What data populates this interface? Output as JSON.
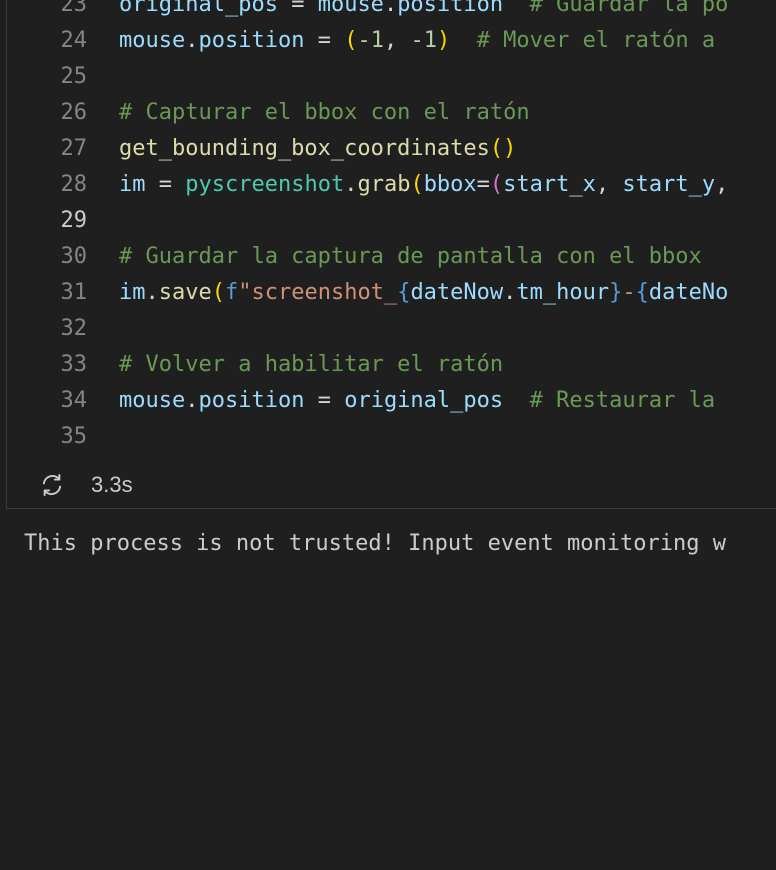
{
  "colors": {
    "background": "#1f1f1f",
    "line_number": "#858585",
    "line_number_current": "#cccccc",
    "variable": "#9cdcfe",
    "function": "#dcdcaa",
    "class": "#4ec9b0",
    "number": "#b5cea8",
    "string": "#ce9178",
    "comment": "#6a9955",
    "bracket_1": "#ffd700",
    "bracket_2": "#da70d6",
    "bracket_3": "#179fff"
  },
  "editor": {
    "current_line": 29,
    "lines": [
      {
        "num": "23",
        "tokens": [
          {
            "t": "original_pos",
            "c": "var"
          },
          {
            "t": " = ",
            "c": "op"
          },
          {
            "t": "mouse",
            "c": "var"
          },
          {
            "t": ".",
            "c": "op"
          },
          {
            "t": "position",
            "c": "var"
          },
          {
            "t": "  # Guardar la po",
            "c": "com"
          }
        ]
      },
      {
        "num": "24",
        "tokens": [
          {
            "t": "mouse",
            "c": "var"
          },
          {
            "t": ".",
            "c": "op"
          },
          {
            "t": "position",
            "c": "var"
          },
          {
            "t": " = ",
            "c": "op"
          },
          {
            "t": "(",
            "c": "br1"
          },
          {
            "t": "-1",
            "c": "num"
          },
          {
            "t": ", ",
            "c": "op"
          },
          {
            "t": "-1",
            "c": "num"
          },
          {
            "t": ")",
            "c": "br1"
          },
          {
            "t": "  # Mover el ratón a",
            "c": "com"
          }
        ]
      },
      {
        "num": "25",
        "tokens": []
      },
      {
        "num": "26",
        "tokens": [
          {
            "t": "# Capturar el bbox con el ratón",
            "c": "com"
          }
        ]
      },
      {
        "num": "27",
        "tokens": [
          {
            "t": "get_bounding_box_coordinates",
            "c": "fn"
          },
          {
            "t": "()",
            "c": "br1"
          }
        ]
      },
      {
        "num": "28",
        "tokens": [
          {
            "t": "im",
            "c": "var"
          },
          {
            "t": " = ",
            "c": "op"
          },
          {
            "t": "pyscreenshot",
            "c": "cls"
          },
          {
            "t": ".",
            "c": "op"
          },
          {
            "t": "grab",
            "c": "fn"
          },
          {
            "t": "(",
            "c": "br1"
          },
          {
            "t": "bbox",
            "c": "var"
          },
          {
            "t": "=",
            "c": "op"
          },
          {
            "t": "(",
            "c": "br2"
          },
          {
            "t": "start_x",
            "c": "var"
          },
          {
            "t": ", ",
            "c": "op"
          },
          {
            "t": "start_y",
            "c": "var"
          },
          {
            "t": ",",
            "c": "op"
          }
        ]
      },
      {
        "num": "29",
        "tokens": []
      },
      {
        "num": "30",
        "tokens": [
          {
            "t": "# Guardar la captura de pantalla con el bbox",
            "c": "com"
          }
        ]
      },
      {
        "num": "31",
        "tokens": [
          {
            "t": "im",
            "c": "var"
          },
          {
            "t": ".",
            "c": "op"
          },
          {
            "t": "save",
            "c": "fn"
          },
          {
            "t": "(",
            "c": "br1"
          },
          {
            "t": "f",
            "c": "kw"
          },
          {
            "t": "\"screenshot_",
            "c": "str"
          },
          {
            "t": "{",
            "c": "kw"
          },
          {
            "t": "dateNow",
            "c": "var"
          },
          {
            "t": ".",
            "c": "op"
          },
          {
            "t": "tm_hour",
            "c": "var"
          },
          {
            "t": "}",
            "c": "kw"
          },
          {
            "t": "-",
            "c": "str"
          },
          {
            "t": "{",
            "c": "kw"
          },
          {
            "t": "dateNo",
            "c": "var"
          }
        ]
      },
      {
        "num": "32",
        "tokens": []
      },
      {
        "num": "33",
        "tokens": [
          {
            "t": "# Volver a habilitar el ratón",
            "c": "com"
          }
        ]
      },
      {
        "num": "34",
        "tokens": [
          {
            "t": "mouse",
            "c": "var"
          },
          {
            "t": ".",
            "c": "op"
          },
          {
            "t": "position",
            "c": "var"
          },
          {
            "t": " = ",
            "c": "op"
          },
          {
            "t": "original_pos",
            "c": "var"
          },
          {
            "t": "  # Restaurar la",
            "c": "com"
          }
        ]
      },
      {
        "num": "35",
        "tokens": []
      }
    ]
  },
  "status": {
    "icon": "sync-icon",
    "duration": "3.3s"
  },
  "output": {
    "text": "This process is not trusted! Input event monitoring w"
  }
}
